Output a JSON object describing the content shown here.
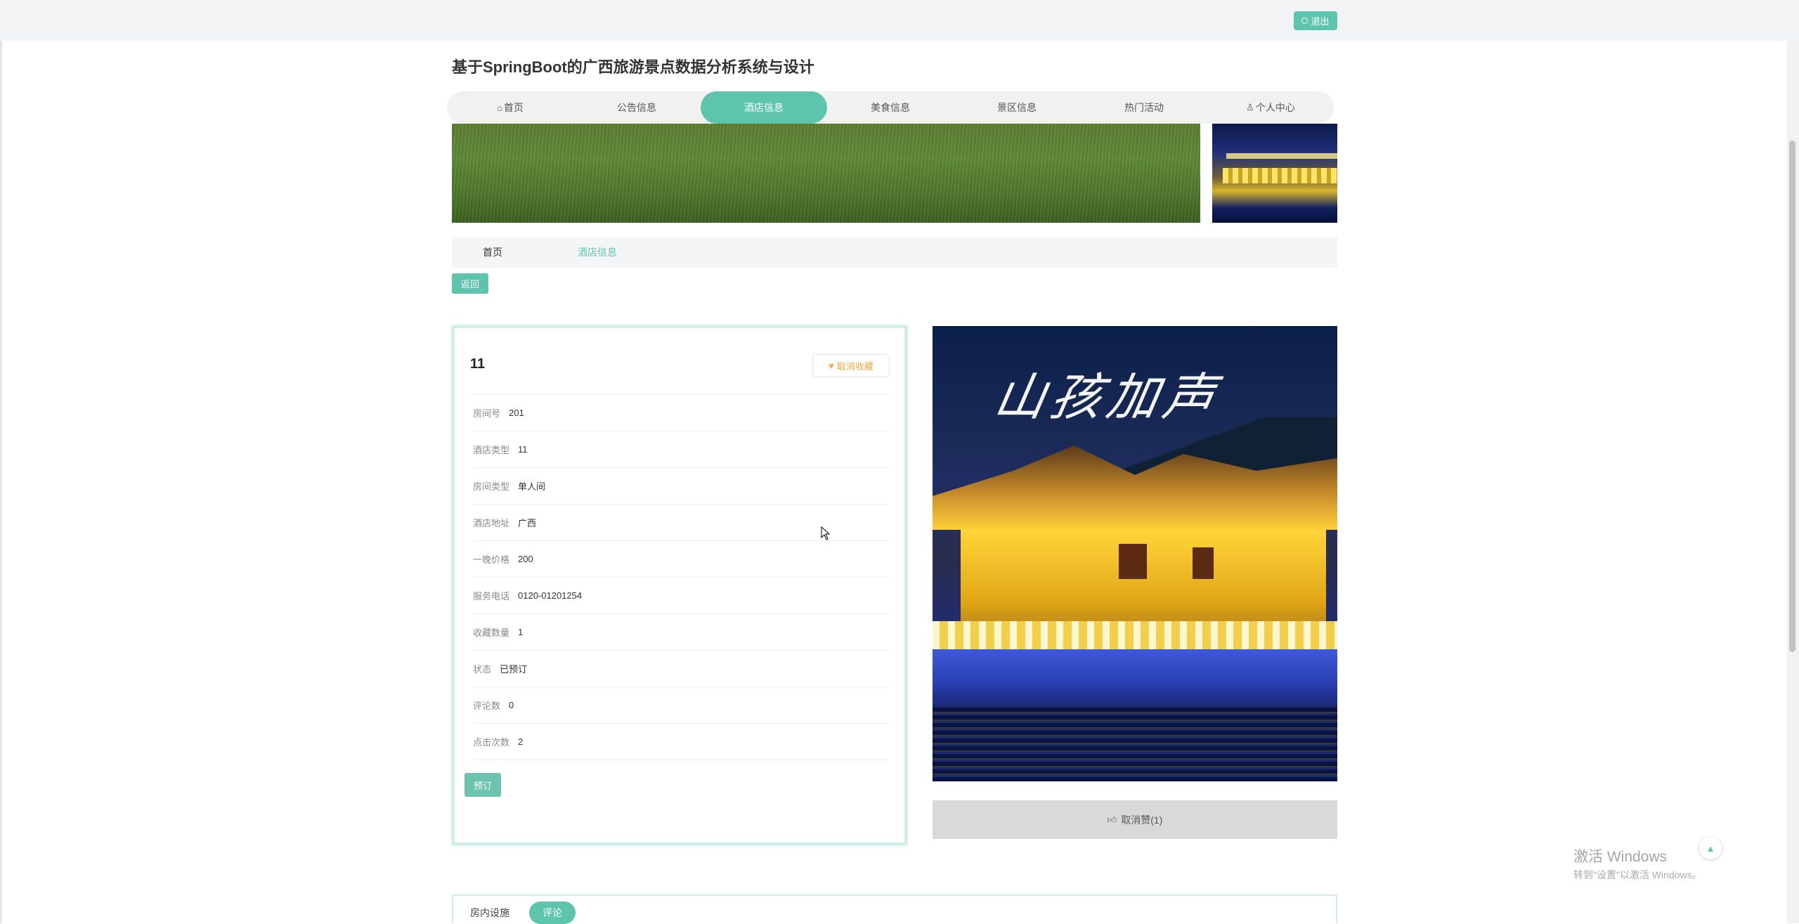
{
  "topbar": {
    "logout_label": "退出"
  },
  "site": {
    "title": "基于SpringBoot的广西旅游景点数据分析系统与设计"
  },
  "nav": {
    "items": [
      {
        "label": "首页",
        "icon": "home-icon"
      },
      {
        "label": "公告信息"
      },
      {
        "label": "酒店信息",
        "active": true
      },
      {
        "label": "美食信息"
      },
      {
        "label": "景区信息"
      },
      {
        "label": "热门活动"
      },
      {
        "label": "个人中心",
        "icon": "user-icon"
      }
    ]
  },
  "breadcrumb": {
    "home": "首页",
    "current": "酒店信息"
  },
  "back_label": "返回",
  "detail": {
    "title": "11",
    "favorite_label": "取消收藏",
    "fields": [
      {
        "label": "房间号",
        "value": "201"
      },
      {
        "label": "酒店类型",
        "value": "11"
      },
      {
        "label": "房间类型",
        "value": "单人间"
      },
      {
        "label": "酒店地址",
        "value": "广西"
      },
      {
        "label": "一晚价格",
        "value": "200"
      },
      {
        "label": "服务电话",
        "value": "0120-01201254"
      },
      {
        "label": "收藏数量",
        "value": "1"
      },
      {
        "label": "状态",
        "value": "已预订"
      },
      {
        "label": "评论数",
        "value": "0"
      },
      {
        "label": "点击次数",
        "value": "2"
      }
    ],
    "book_label": "预订"
  },
  "photo": {
    "calligraphy": "山孩加声"
  },
  "like": {
    "label": "取消赞(1)"
  },
  "tabs": {
    "facilities": "房内设施",
    "comments": "评论"
  },
  "watermark": {
    "title": "激活 Windows",
    "subtitle": "转到\"设置\"以激活 Windows。"
  },
  "colors": {
    "accent": "#5ec4ad",
    "favorite": "#f0a743"
  }
}
